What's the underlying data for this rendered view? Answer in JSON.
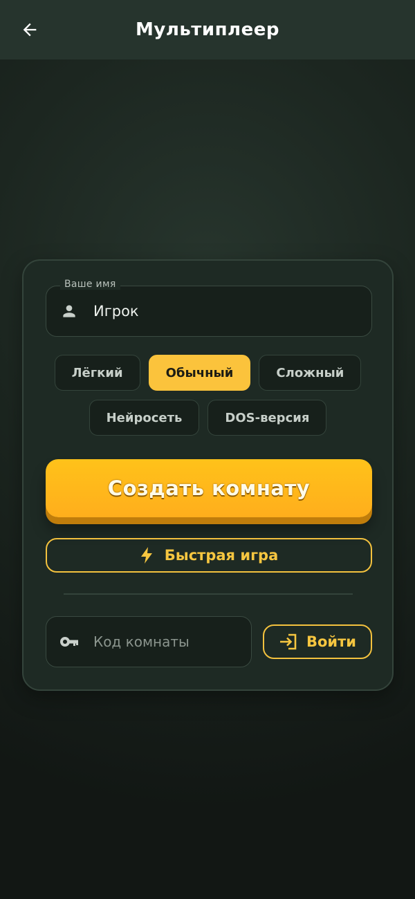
{
  "header": {
    "title": "Мультиплеер",
    "back_icon": "arrow-left-icon"
  },
  "name_field": {
    "label": "Ваше имя",
    "value": "Игрок",
    "icon": "person-icon"
  },
  "difficulty": {
    "options": [
      {
        "label": "Лёгкий",
        "selected": false
      },
      {
        "label": "Обычный",
        "selected": true
      },
      {
        "label": "Сложный",
        "selected": false
      },
      {
        "label": "Нейросеть",
        "selected": false
      },
      {
        "label": "DOS-версия",
        "selected": false
      }
    ]
  },
  "actions": {
    "create_label": "Создать комнату",
    "quick_label": "Быстрая игра",
    "quick_icon": "lightning-icon"
  },
  "join": {
    "code_placeholder": "Код комнаты",
    "code_icon": "key-icon",
    "join_label": "Войти",
    "join_icon": "login-icon"
  },
  "colors": {
    "accent": "#fbc33c",
    "background": "#1c2620",
    "card": "#1e2a24"
  }
}
